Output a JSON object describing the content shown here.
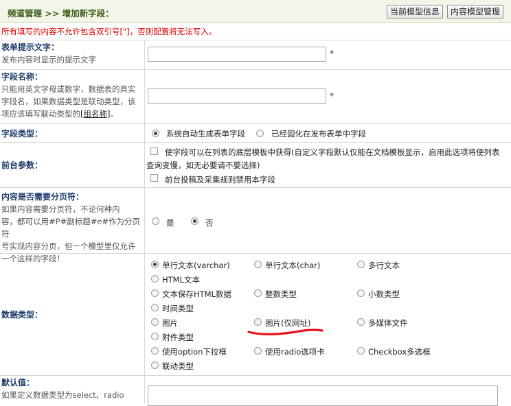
{
  "header": {
    "breadcrumb": "频道管理 >> 增加新字段：",
    "btn_model_info": "当前模型信息",
    "btn_model_manage": "内容模型管理"
  },
  "warning": "所有填写的内容不允许包含双引号[\"]，否则配置将无法写入。",
  "form": {
    "itemname": {
      "title": "表单提示文字：",
      "desc": "发布内容时显示的提示文字",
      "star": "*"
    },
    "fieldname": {
      "title": "字段名称：",
      "desc1": "只能用英文字母或数字，数据表的真实",
      "desc2": "字段名，如果数据类型是联动类型，该",
      "desc3_prefix": "项应该填写联动类型的",
      "desc3_link": "[组名称]",
      "desc3_suffix": "。",
      "star": "*"
    },
    "fieldtype": {
      "title": "字段类型：",
      "opt_auto": "系统自动生成表单字段",
      "opt_fixed": "已经固化在发布表单中字段"
    },
    "frontparam": {
      "title": "前台参数：",
      "opt1_line1": "使字段可以在列表的底层模板中获得(自定义字段默认仅能在文档模板显示，启用此选项将使列表",
      "opt1_line2": "查询变慢，如无必要请不要选择)",
      "opt2": "前台投稿及采集规则禁用本字段"
    },
    "pagebreak": {
      "title": "内容是否需要分页符：",
      "desc1": "如果内容需要分页符，不论何种内",
      "desc2": "容，都可以用#P#副标题#e#作为分页符",
      "desc3": "号实现内容分页，但一个模型里仅允许",
      "desc4": "一个这样的字段！",
      "opt_yes": "是",
      "opt_no": "否"
    },
    "datatype": {
      "title": "数据类型：",
      "options": {
        "varchar": "单行文本(varchar)",
        "char": "单行文本(char)",
        "multitext": "多行文本",
        "htmltext": "HTML文本",
        "textdata": "文本保存HTML数据",
        "int": "整数类型",
        "float": "小数类型",
        "datetime": "时间类型",
        "img": "图片",
        "imgfile": "图片(仅网址)",
        "media": "多媒体文件",
        "addon": "附件类型",
        "select": "使用option下拉框",
        "radio": "使用radio选项卡",
        "checkbox": "Checkbox多选框",
        "stepselect": "联动类型"
      }
    },
    "default": {
      "title": "默认值：",
      "desc": "如果定义数据类型为select、radio"
    }
  },
  "colors": {
    "accent": "#3b5b14",
    "warning": "#e00000",
    "annotation": "#e8101a"
  }
}
